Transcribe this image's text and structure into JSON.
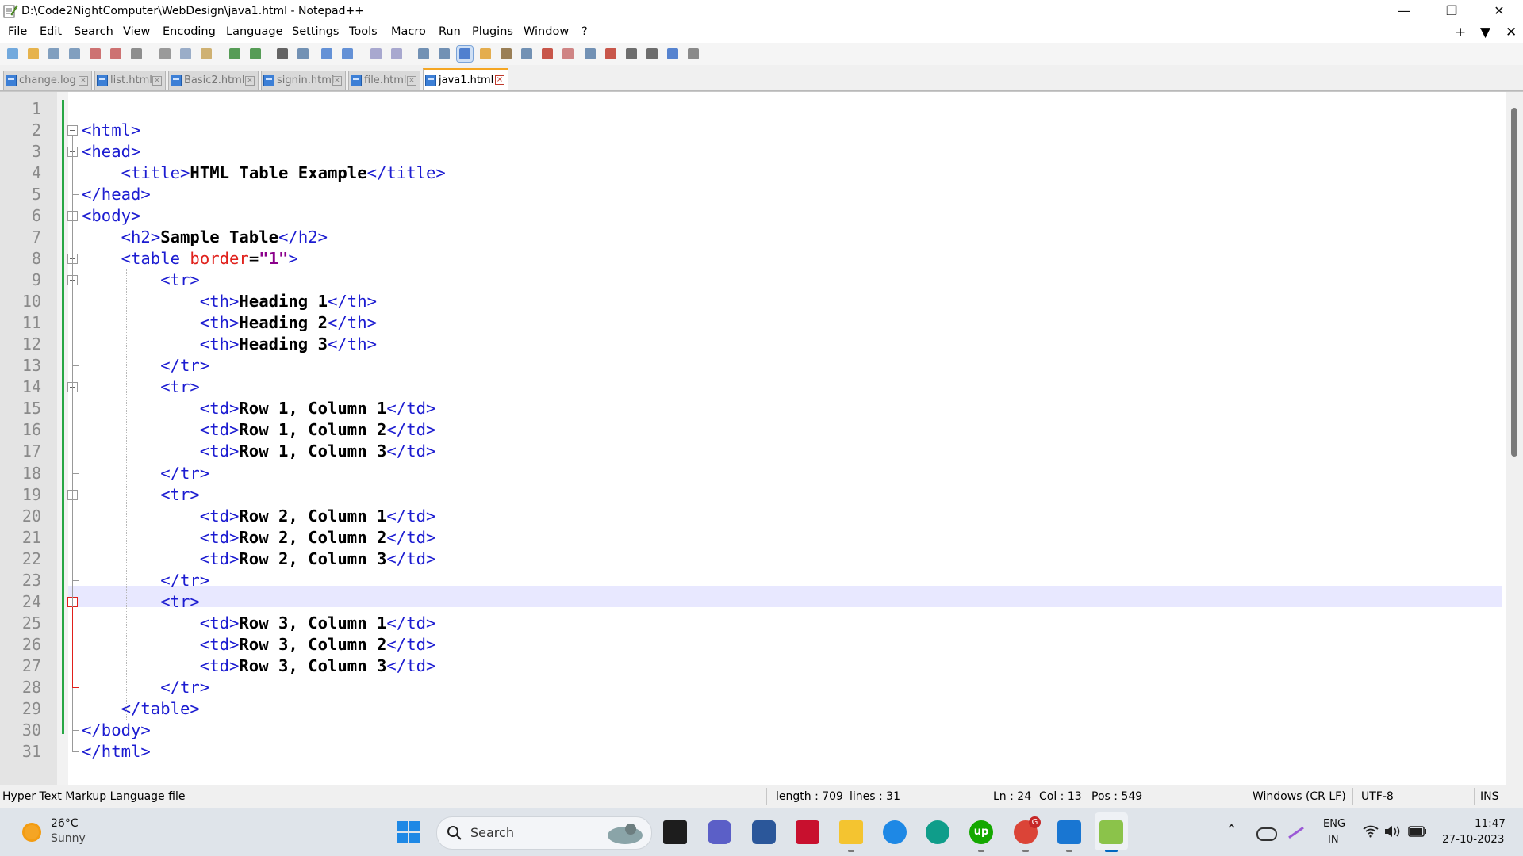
{
  "window": {
    "title": "D:\\Code2NightComputer\\WebDesign\\java1.html - Notepad++",
    "minimize_glyph": "—",
    "restore_glyph": "❐",
    "close_glyph": "✕"
  },
  "menu": {
    "items": [
      "File",
      "Edit",
      "Search",
      "View",
      "Encoding",
      "Language",
      "Settings",
      "Tools",
      "Macro",
      "Run",
      "Plugins",
      "Window",
      "?"
    ],
    "right_controls": [
      "+",
      "▼",
      "✕"
    ]
  },
  "toolbar": {
    "icons": [
      "new-file-icon",
      "open-file-icon",
      "save-icon",
      "save-all-icon",
      "close-icon",
      "close-all-icon",
      "print-icon",
      "cut-icon",
      "copy-icon",
      "paste-icon",
      "undo-icon",
      "redo-icon",
      "find-icon",
      "replace-icon",
      "zoom-in-icon",
      "zoom-out-icon",
      "sync-vertical-icon",
      "sync-horizontal-icon",
      "word-wrap-icon",
      "show-all-chars-icon",
      "indent-guide-icon",
      "user-language-icon",
      "doc-map-icon",
      "function-list-icon",
      "folder-workspace-icon",
      "document-list-icon",
      "monitoring-icon",
      "record-macro-icon",
      "stop-record-icon",
      "play-macro-icon",
      "run-macro-multiple-icon",
      "save-macro-icon"
    ]
  },
  "tabs": [
    {
      "label": "change.log",
      "active": false
    },
    {
      "label": "list.html",
      "active": false
    },
    {
      "label": "Basic2.html",
      "active": false
    },
    {
      "label": "signin.html",
      "active": false
    },
    {
      "label": "file.html",
      "active": false
    },
    {
      "label": "java1.html",
      "active": true
    }
  ],
  "editor": {
    "current_line": 24,
    "lines": [
      {
        "n": "1",
        "text": ""
      },
      {
        "n": "2",
        "text": "<html>"
      },
      {
        "n": "3",
        "text": "<head>"
      },
      {
        "n": "4",
        "text": "    <title>HTML Table Example</title>"
      },
      {
        "n": "5",
        "text": "</head>"
      },
      {
        "n": "6",
        "text": "<body>"
      },
      {
        "n": "7",
        "text": "    <h2>Sample Table</h2>"
      },
      {
        "n": "8",
        "text": "    <table border=\"1\">"
      },
      {
        "n": "9",
        "text": "        <tr>"
      },
      {
        "n": "10",
        "text": "            <th>Heading 1</th>"
      },
      {
        "n": "11",
        "text": "            <th>Heading 2</th>"
      },
      {
        "n": "12",
        "text": "            <th>Heading 3</th>"
      },
      {
        "n": "13",
        "text": "        </tr>"
      },
      {
        "n": "14",
        "text": "        <tr>"
      },
      {
        "n": "15",
        "text": "            <td>Row 1, Column 1</td>"
      },
      {
        "n": "16",
        "text": "            <td>Row 1, Column 2</td>"
      },
      {
        "n": "17",
        "text": "            <td>Row 1, Column 3</td>"
      },
      {
        "n": "18",
        "text": "        </tr>"
      },
      {
        "n": "19",
        "text": "        <tr>"
      },
      {
        "n": "20",
        "text": "            <td>Row 2, Column 1</td>"
      },
      {
        "n": "21",
        "text": "            <td>Row 2, Column 2</td>"
      },
      {
        "n": "22",
        "text": "            <td>Row 2, Column 3</td>"
      },
      {
        "n": "23",
        "text": "        </tr>"
      },
      {
        "n": "24",
        "text": "        <tr>"
      },
      {
        "n": "25",
        "text": "            <td>Row 3, Column 1</td>"
      },
      {
        "n": "26",
        "text": "            <td>Row 3, Column 2</td>"
      },
      {
        "n": "27",
        "text": "            <td>Row 3, Column 3</td>"
      },
      {
        "n": "28",
        "text": "        </tr>"
      },
      {
        "n": "29",
        "text": "    </table>"
      },
      {
        "n": "30",
        "text": "</body>"
      },
      {
        "n": "31",
        "text": "</html>"
      }
    ]
  },
  "status": {
    "file_type": "Hyper Text Markup Language file",
    "length": "length : 709",
    "lines": "lines : 31",
    "ln": "Ln : 24",
    "col": "Col : 13",
    "pos": "Pos : 549",
    "eol": "Windows (CR LF)",
    "encoding": "UTF-8",
    "mode": "INS"
  },
  "taskbar": {
    "weather_temp": "26°C",
    "weather_desc": "Sunny",
    "search_label": "Search",
    "lang_top": "ENG",
    "lang_bottom": "IN",
    "time": "11:47",
    "date": "27-10-2023",
    "chrome_badge": "G",
    "upwork_label": "up"
  },
  "colors": {
    "tag": "#1c1cd1",
    "attribute": "#e0201b",
    "string": "#8b008b",
    "text": "#000000",
    "current_line": "#e8e8ff",
    "change_bar": "#28a745",
    "active_tab_accent": "#f5a623"
  }
}
